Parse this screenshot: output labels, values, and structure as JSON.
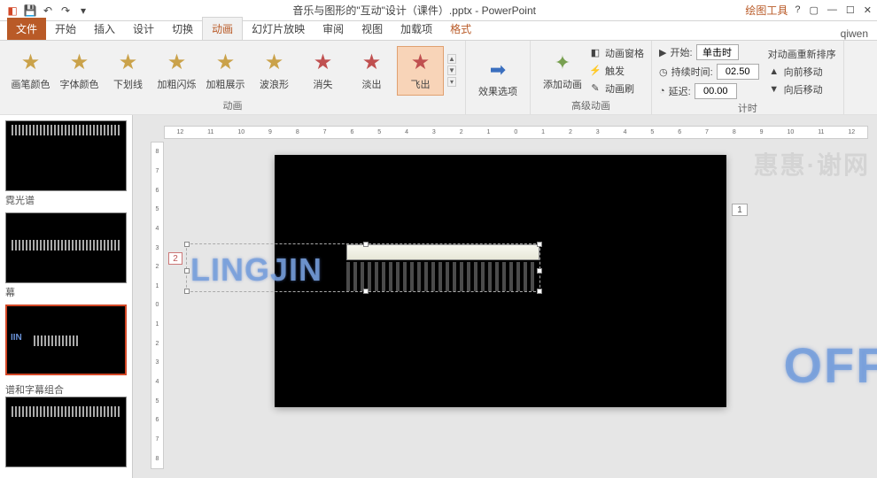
{
  "title": "音乐与图形的\"互动\"设计（课件）.pptx - PowerPoint",
  "contextual_tab": "绘图工具",
  "tabs": {
    "file": "文件",
    "items": [
      "开始",
      "插入",
      "设计",
      "切换",
      "动画",
      "幻灯片放映",
      "审阅",
      "视图",
      "加载项",
      "格式"
    ],
    "active": "动画",
    "user": "qiwen"
  },
  "animations": [
    {
      "name": "画笔颜色",
      "color": "#caa24a"
    },
    {
      "name": "字体颜色",
      "color": "#caa24a"
    },
    {
      "name": "下划线",
      "color": "#caa24a"
    },
    {
      "name": "加粗闪烁",
      "color": "#caa24a"
    },
    {
      "name": "加粗展示",
      "color": "#caa24a"
    },
    {
      "name": "波浪形",
      "color": "#caa24a"
    },
    {
      "name": "消失",
      "color": "#c05050"
    },
    {
      "name": "淡出",
      "color": "#c05050"
    },
    {
      "name": "飞出",
      "color": "#c05050"
    }
  ],
  "group_labels": {
    "anim": "动画",
    "adv": "高级动画",
    "timing": "计时"
  },
  "effect_options": "效果选项",
  "add_anim": "添加动画",
  "adv": {
    "pane": "动画窗格",
    "trigger": "触发",
    "painter": "动画刷"
  },
  "timing": {
    "start_label": "开始:",
    "start_value": "单击时",
    "duration_label": "持续时间:",
    "duration_value": "02.50",
    "delay_label": "延迟:",
    "delay_value": "00.00",
    "reorder": "对动画重新排序",
    "move_earlier": "向前移动",
    "move_later": "向后移动"
  },
  "thumbs": [
    {
      "caption": "霓光谱"
    },
    {
      "caption": "幕"
    },
    {
      "caption": "",
      "active": true
    },
    {
      "caption": "谱和字幕组合"
    }
  ],
  "slide": {
    "text": "LINGJIN",
    "anim_tag": "2",
    "note_badge": "1"
  },
  "overflow_text": "OFFI",
  "watermark": "惠惠·谢网",
  "hruler": [
    "12",
    "11",
    "10",
    "9",
    "8",
    "7",
    "6",
    "5",
    "4",
    "3",
    "2",
    "1",
    "0",
    "1",
    "2",
    "3",
    "4",
    "5",
    "6",
    "7",
    "8",
    "9",
    "10",
    "11",
    "12"
  ],
  "vruler": [
    "8",
    "7",
    "6",
    "5",
    "4",
    "3",
    "2",
    "1",
    "0",
    "1",
    "2",
    "3",
    "4",
    "5",
    "6",
    "7",
    "8"
  ]
}
